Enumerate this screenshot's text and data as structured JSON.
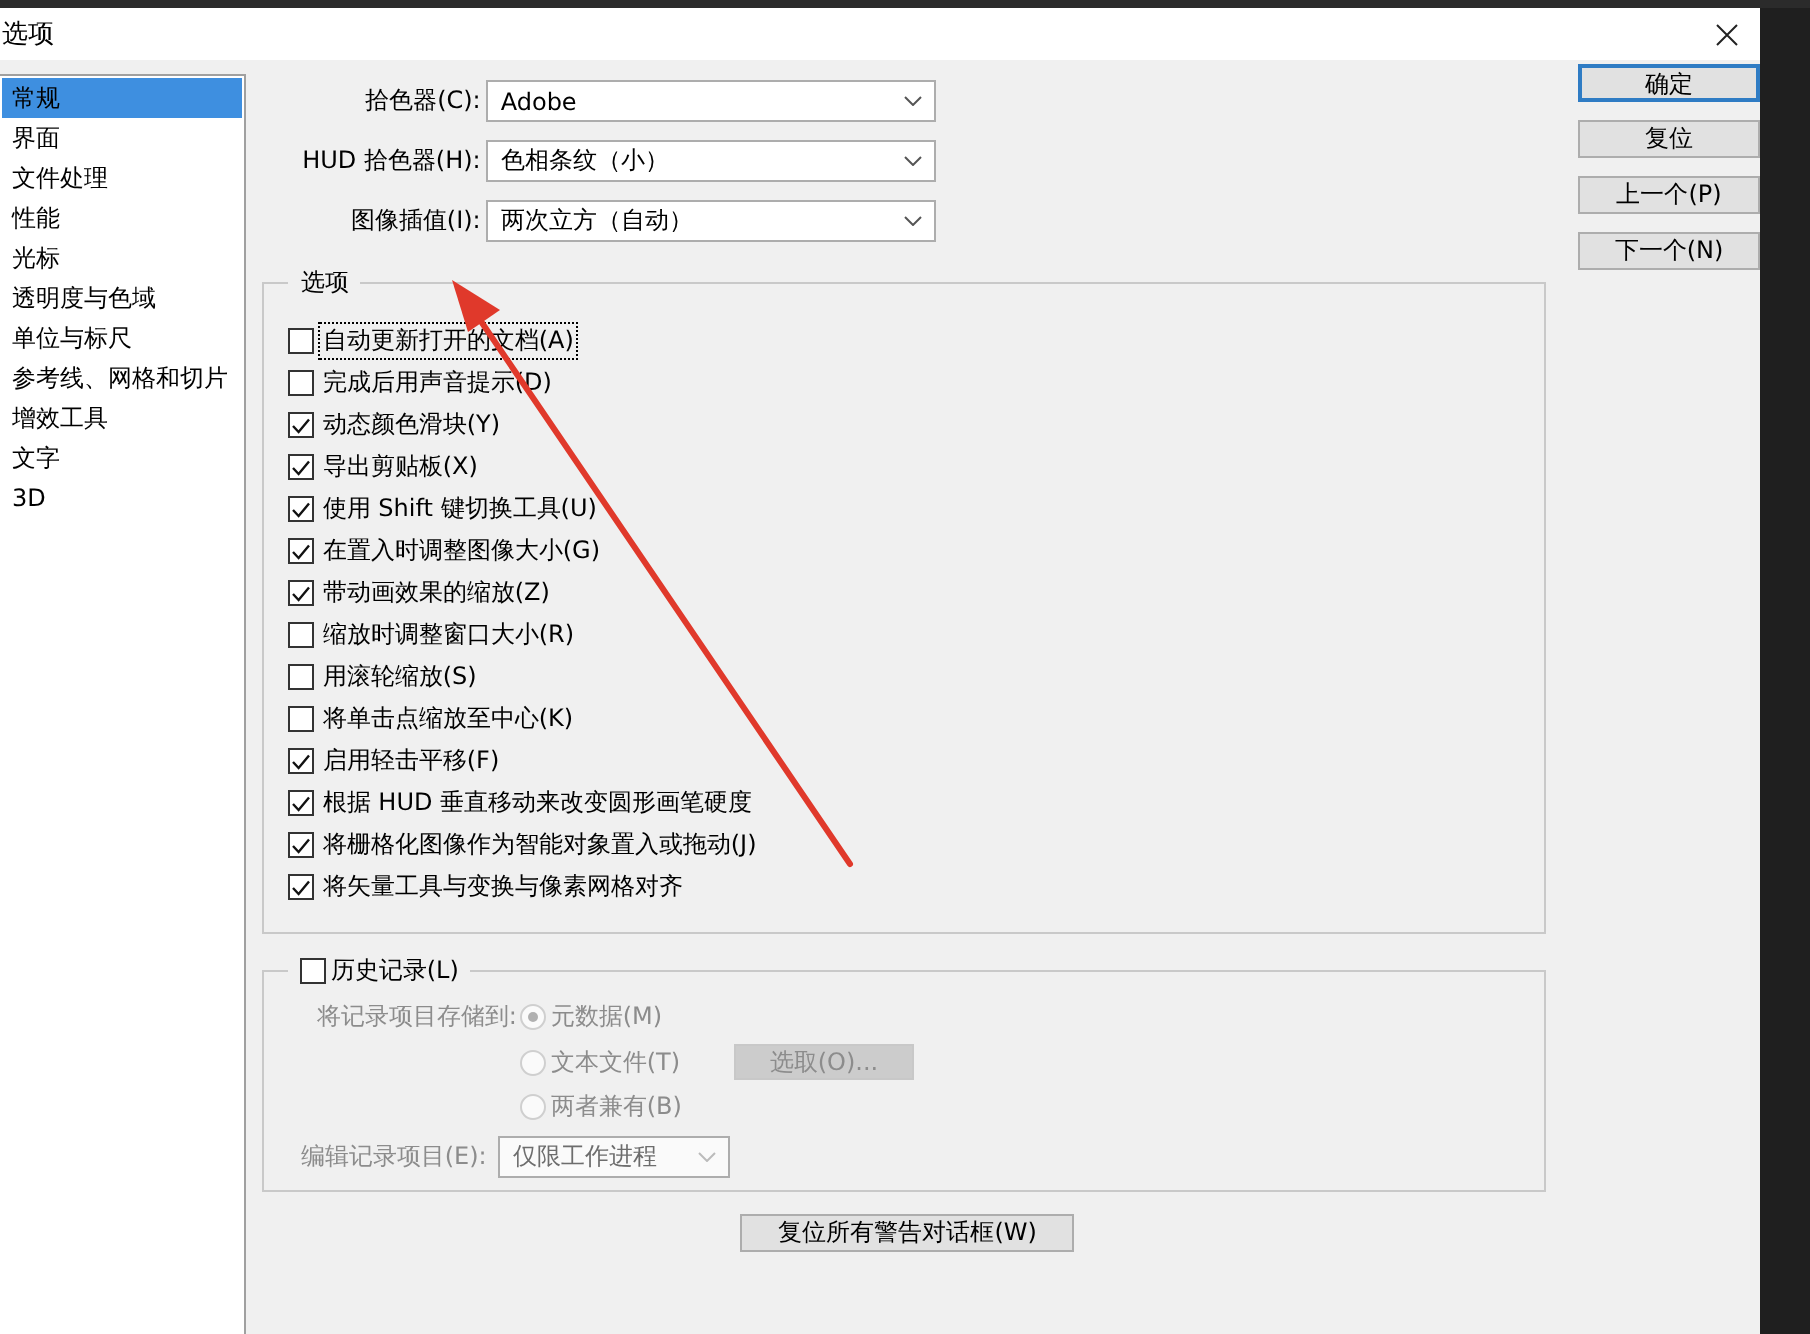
{
  "window": {
    "title": "选项"
  },
  "sidebar": {
    "items": [
      {
        "label": "常规",
        "selected": true
      },
      {
        "label": "界面",
        "selected": false
      },
      {
        "label": "文件处理",
        "selected": false
      },
      {
        "label": "性能",
        "selected": false
      },
      {
        "label": "光标",
        "selected": false
      },
      {
        "label": "透明度与色域",
        "selected": false
      },
      {
        "label": "单位与标尺",
        "selected": false
      },
      {
        "label": "参考线、网格和切片",
        "selected": false
      },
      {
        "label": "增效工具",
        "selected": false
      },
      {
        "label": "文字",
        "selected": false
      },
      {
        "label": "3D",
        "selected": false
      }
    ]
  },
  "fields": [
    {
      "label": "拾色器(C):",
      "value": "Adobe"
    },
    {
      "label": "HUD 拾色器(H):",
      "value": "色相条纹（小）"
    },
    {
      "label": "图像插值(I):",
      "value": "两次立方（自动）"
    }
  ],
  "options": {
    "title": "选项",
    "items": [
      {
        "label": "自动更新打开的文档(A)",
        "checked": false,
        "focused": true
      },
      {
        "label": "完成后用声音提示(D)",
        "checked": false,
        "focused": false
      },
      {
        "label": "动态颜色滑块(Y)",
        "checked": true,
        "focused": false
      },
      {
        "label": "导出剪贴板(X)",
        "checked": true,
        "focused": false
      },
      {
        "label": "使用 Shift 键切换工具(U)",
        "checked": true,
        "focused": false
      },
      {
        "label": "在置入时调整图像大小(G)",
        "checked": true,
        "focused": false
      },
      {
        "label": "带动画效果的缩放(Z)",
        "checked": true,
        "focused": false
      },
      {
        "label": "缩放时调整窗口大小(R)",
        "checked": false,
        "focused": false
      },
      {
        "label": "用滚轮缩放(S)",
        "checked": false,
        "focused": false
      },
      {
        "label": "将单击点缩放至中心(K)",
        "checked": false,
        "focused": false
      },
      {
        "label": "启用轻击平移(F)",
        "checked": true,
        "focused": false
      },
      {
        "label": "根据 HUD 垂直移动来改变圆形画笔硬度",
        "checked": true,
        "focused": false
      },
      {
        "label": "将栅格化图像作为智能对象置入或拖动(J)",
        "checked": true,
        "focused": false
      },
      {
        "label": "将矢量工具与变换与像素网格对齐",
        "checked": true,
        "focused": false
      }
    ]
  },
  "history": {
    "label": "历史记录(L)",
    "checked": false,
    "save_label": "将记录项目存储到:",
    "save_options": [
      {
        "label": "元数据(M)",
        "selected": true
      },
      {
        "label": "文本文件(T)",
        "selected": false
      },
      {
        "label": "两者兼有(B)",
        "selected": false
      }
    ],
    "choose_button": "选取(O)...",
    "edit_label": "编辑记录项目(E):",
    "edit_value": "仅限工作进程"
  },
  "reset_warnings_button": "复位所有警告对话框(W)",
  "buttons": [
    {
      "label": "确定",
      "default": true
    },
    {
      "label": "复位",
      "default": false
    },
    {
      "label": "上一个(P)",
      "default": false
    },
    {
      "label": "下一个(N)",
      "default": false
    }
  ]
}
